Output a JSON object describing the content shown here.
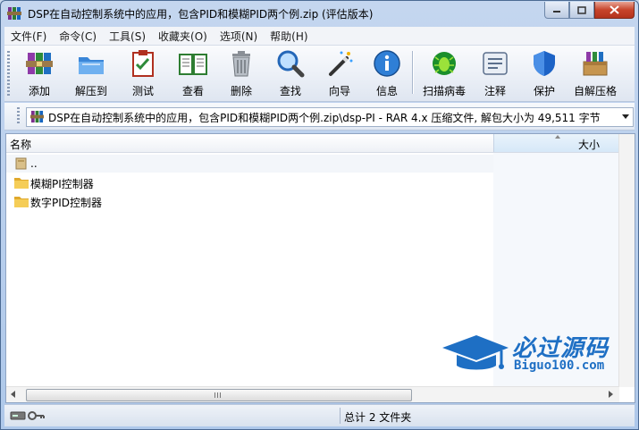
{
  "window": {
    "title": "DSP在自动控制系统中的应用，包含PID和模糊PID两个例.zip (评估版本)"
  },
  "menu": [
    "文件(F)",
    "命令(C)",
    "工具(S)",
    "收藏夹(O)",
    "选项(N)",
    "帮助(H)"
  ],
  "toolbar": [
    {
      "label": "添加",
      "icon": "books-add-icon"
    },
    {
      "label": "解压到",
      "icon": "folder-extract-icon"
    },
    {
      "label": "测试",
      "icon": "checklist-test-icon"
    },
    {
      "label": "查看",
      "icon": "book-view-icon"
    },
    {
      "label": "删除",
      "icon": "trash-delete-icon"
    },
    {
      "label": "查找",
      "icon": "magnifier-find-icon"
    },
    {
      "label": "向导",
      "icon": "magic-wand-icon"
    },
    {
      "label": "信息",
      "icon": "info-icon"
    },
    {
      "label": "扫描病毒",
      "icon": "virus-scan-icon"
    },
    {
      "label": "注释",
      "icon": "comment-icon"
    },
    {
      "label": "保护",
      "icon": "shield-protect-icon"
    },
    {
      "label": "自解压格",
      "icon": "sfx-box-icon"
    }
  ],
  "address": {
    "path": "DSP在自动控制系统中的应用，包含PID和模糊PID两个例.zip\\dsp-PI - RAR 4.x 压缩文件, 解包大小为 49,511 字节"
  },
  "columns": {
    "name": "名称",
    "size": "大小"
  },
  "rows": [
    {
      "name": "..",
      "type": "parent"
    },
    {
      "name": "模糊PI控制器",
      "type": "folder"
    },
    {
      "name": "数字PID控制器",
      "type": "folder"
    }
  ],
  "status": {
    "summary": "总计 2 文件夹"
  },
  "watermark": {
    "cn": "必过源码",
    "en": "Biguo100.com"
  },
  "colors": {
    "folder": "#f2c94c",
    "accent": "#1e6fc4",
    "close": "#c7442b"
  }
}
